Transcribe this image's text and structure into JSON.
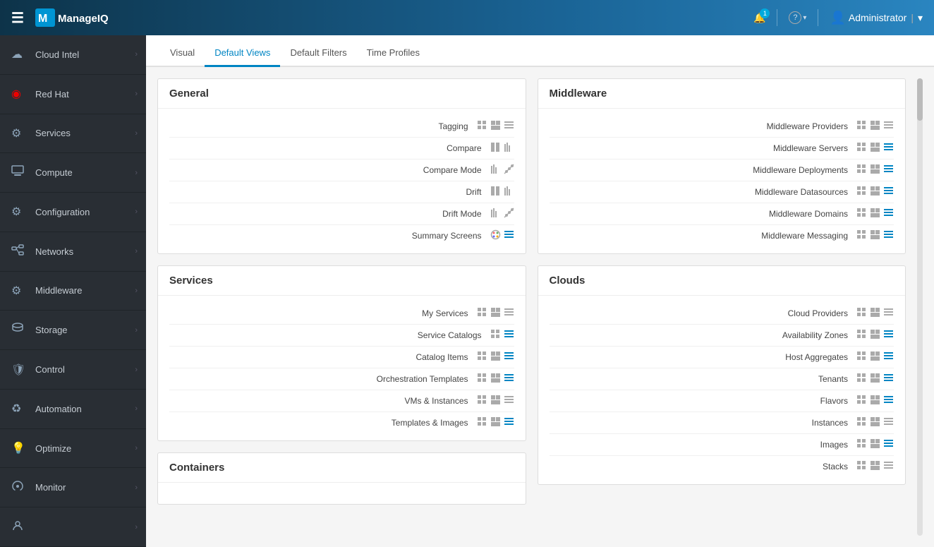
{
  "app": {
    "title": "ManageIQ",
    "hamburger": "☰"
  },
  "topnav": {
    "bell_count": "1",
    "help_label": "?",
    "user_label": "Administrator",
    "dropdown_arrow": "▾"
  },
  "sidebar": {
    "items": [
      {
        "id": "cloud-intel",
        "label": "Cloud Intel",
        "icon": "☁"
      },
      {
        "id": "red-hat",
        "label": "Red Hat",
        "icon": "🔴"
      },
      {
        "id": "services",
        "label": "Services",
        "icon": "⚙"
      },
      {
        "id": "compute",
        "label": "Compute",
        "icon": "🖥"
      },
      {
        "id": "configuration",
        "label": "Configuration",
        "icon": "⚙"
      },
      {
        "id": "networks",
        "label": "Networks",
        "icon": "🔗"
      },
      {
        "id": "middleware",
        "label": "Middleware",
        "icon": "⚙"
      },
      {
        "id": "storage",
        "label": "Storage",
        "icon": "💾"
      },
      {
        "id": "control",
        "label": "Control",
        "icon": "🛡"
      },
      {
        "id": "automation",
        "label": "Automation",
        "icon": "♻"
      },
      {
        "id": "optimize",
        "label": "Optimize",
        "icon": "💡"
      },
      {
        "id": "monitor",
        "label": "Monitor",
        "icon": "❤"
      }
    ]
  },
  "tabs": [
    {
      "id": "visual",
      "label": "Visual",
      "active": false
    },
    {
      "id": "default-views",
      "label": "Default Views",
      "active": true
    },
    {
      "id": "default-filters",
      "label": "Default Filters",
      "active": false
    },
    {
      "id": "time-profiles",
      "label": "Time Profiles",
      "active": false
    }
  ],
  "sections": {
    "general": {
      "title": "General",
      "rows": [
        {
          "label": "Tagging",
          "icons": [
            {
              "type": "grid4",
              "active": false
            },
            {
              "type": "grid2",
              "active": false
            },
            {
              "type": "list",
              "active": false
            }
          ]
        },
        {
          "label": "Compare",
          "icons": [
            {
              "type": "col2",
              "active": false
            },
            {
              "type": "bar",
              "active": false
            }
          ]
        },
        {
          "label": "Compare Mode",
          "icons": [
            {
              "type": "bar",
              "active": false
            },
            {
              "type": "scatter",
              "active": false
            }
          ]
        },
        {
          "label": "Drift",
          "icons": [
            {
              "type": "col2",
              "active": false
            },
            {
              "type": "bar",
              "active": false
            }
          ]
        },
        {
          "label": "Drift Mode",
          "icons": [
            {
              "type": "bar",
              "active": false
            },
            {
              "type": "scatter",
              "active": false
            }
          ]
        },
        {
          "label": "Summary Screens",
          "icons": [
            {
              "type": "palette",
              "active": false
            },
            {
              "type": "list",
              "active": true
            }
          ]
        }
      ]
    },
    "services": {
      "title": "Services",
      "rows": [
        {
          "label": "My Services",
          "icons": [
            {
              "type": "grid4",
              "active": false
            },
            {
              "type": "grid2",
              "active": false
            },
            {
              "type": "list",
              "active": false
            }
          ]
        },
        {
          "label": "Service Catalogs",
          "icons": [
            {
              "type": "grid4",
              "active": false
            },
            {
              "type": "list",
              "active": true
            }
          ]
        },
        {
          "label": "Catalog Items",
          "icons": [
            {
              "type": "grid4",
              "active": false
            },
            {
              "type": "grid2",
              "active": false
            },
            {
              "type": "list",
              "active": true
            }
          ]
        },
        {
          "label": "Orchestration Templates",
          "icons": [
            {
              "type": "grid4",
              "active": false
            },
            {
              "type": "grid2",
              "active": false
            },
            {
              "type": "list",
              "active": true
            }
          ]
        },
        {
          "label": "VMs & Instances",
          "icons": [
            {
              "type": "grid4",
              "active": false
            },
            {
              "type": "grid2",
              "active": false
            },
            {
              "type": "list",
              "active": false
            }
          ]
        },
        {
          "label": "Templates & Images",
          "icons": [
            {
              "type": "grid4",
              "active": false
            },
            {
              "type": "grid2",
              "active": false
            },
            {
              "type": "list",
              "active": true
            }
          ]
        }
      ]
    },
    "containers": {
      "title": "Containers",
      "rows": []
    },
    "middleware": {
      "title": "Middleware",
      "rows": [
        {
          "label": "Middleware Providers",
          "icons": [
            {
              "type": "grid4",
              "active": false
            },
            {
              "type": "grid2",
              "active": false
            },
            {
              "type": "list",
              "active": false
            }
          ]
        },
        {
          "label": "Middleware Servers",
          "icons": [
            {
              "type": "grid4",
              "active": false
            },
            {
              "type": "grid2",
              "active": false
            },
            {
              "type": "list",
              "active": true
            }
          ]
        },
        {
          "label": "Middleware Deployments",
          "icons": [
            {
              "type": "grid4",
              "active": false
            },
            {
              "type": "grid2",
              "active": false
            },
            {
              "type": "list",
              "active": true
            }
          ]
        },
        {
          "label": "Middleware Datasources",
          "icons": [
            {
              "type": "grid4",
              "active": false
            },
            {
              "type": "grid2",
              "active": false
            },
            {
              "type": "list",
              "active": true
            }
          ]
        },
        {
          "label": "Middleware Domains",
          "icons": [
            {
              "type": "grid4",
              "active": false
            },
            {
              "type": "grid2",
              "active": false
            },
            {
              "type": "list",
              "active": true
            }
          ]
        },
        {
          "label": "Middleware Messaging",
          "icons": [
            {
              "type": "grid4",
              "active": false
            },
            {
              "type": "grid2",
              "active": false
            },
            {
              "type": "list",
              "active": true
            }
          ]
        }
      ]
    },
    "clouds": {
      "title": "Clouds",
      "rows": [
        {
          "label": "Cloud Providers",
          "icons": [
            {
              "type": "grid4",
              "active": false
            },
            {
              "type": "grid2",
              "active": false
            },
            {
              "type": "list",
              "active": false
            }
          ]
        },
        {
          "label": "Availability Zones",
          "icons": [
            {
              "type": "grid4",
              "active": false
            },
            {
              "type": "grid2",
              "active": false
            },
            {
              "type": "list",
              "active": true
            }
          ]
        },
        {
          "label": "Host Aggregates",
          "icons": [
            {
              "type": "grid4",
              "active": false
            },
            {
              "type": "grid2",
              "active": false
            },
            {
              "type": "list",
              "active": true
            }
          ]
        },
        {
          "label": "Tenants",
          "icons": [
            {
              "type": "grid4",
              "active": false
            },
            {
              "type": "grid2",
              "active": false
            },
            {
              "type": "list",
              "active": true
            }
          ]
        },
        {
          "label": "Flavors",
          "icons": [
            {
              "type": "grid4",
              "active": false
            },
            {
              "type": "grid2",
              "active": false
            },
            {
              "type": "list",
              "active": true
            }
          ]
        },
        {
          "label": "Instances",
          "icons": [
            {
              "type": "grid4",
              "active": false
            },
            {
              "type": "grid2",
              "active": false
            },
            {
              "type": "list",
              "active": false
            }
          ]
        },
        {
          "label": "Images",
          "icons": [
            {
              "type": "grid4",
              "active": false
            },
            {
              "type": "grid2",
              "active": false
            },
            {
              "type": "list",
              "active": true
            }
          ]
        },
        {
          "label": "Stacks",
          "icons": [
            {
              "type": "grid4",
              "active": false
            },
            {
              "type": "grid2",
              "active": false
            },
            {
              "type": "list",
              "active": false
            }
          ]
        }
      ]
    }
  }
}
